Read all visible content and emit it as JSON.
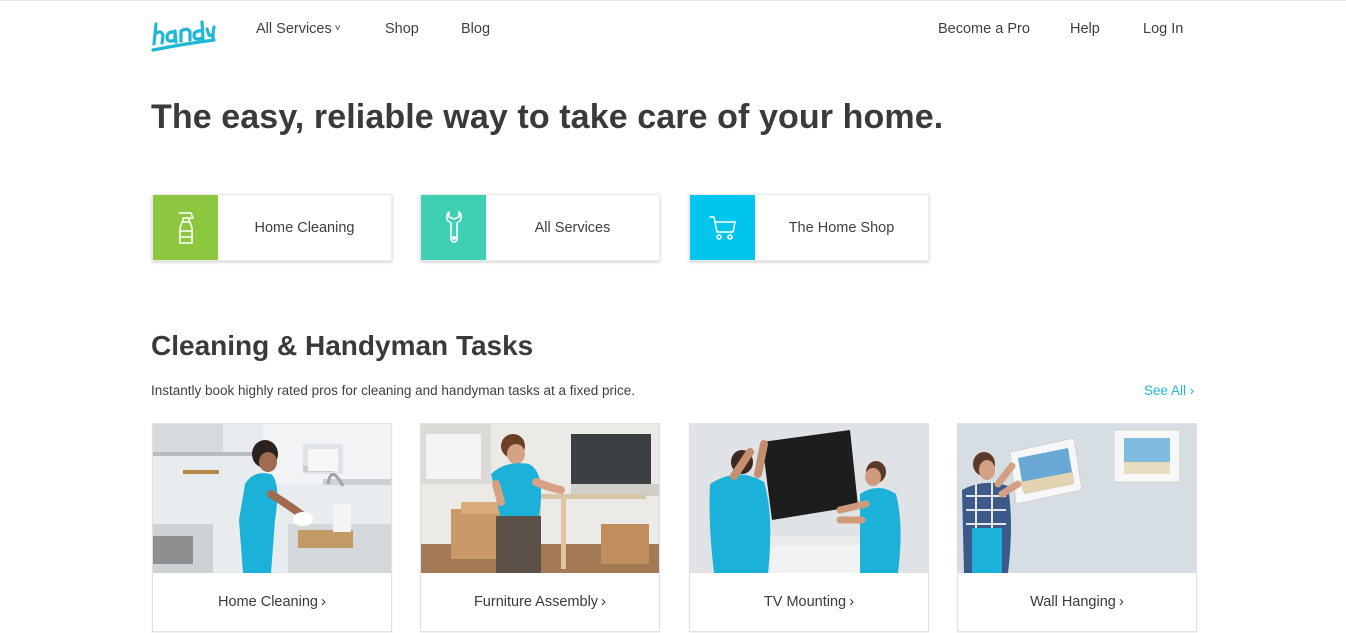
{
  "brand": {
    "logo_text": "handy",
    "accent": "#21b7d4"
  },
  "nav": {
    "left": [
      {
        "label": "All Services",
        "has_chevron": true
      },
      {
        "label": "Shop"
      },
      {
        "label": "Blog"
      }
    ],
    "right": [
      {
        "label": "Become a Pro"
      },
      {
        "label": "Help"
      },
      {
        "label": "Log In"
      }
    ],
    "chevron": "˅"
  },
  "hero": {
    "title": "The easy, reliable way to take care of your home."
  },
  "categories": [
    {
      "label": "Home Cleaning",
      "icon": "spray-bottle-icon",
      "color": "#8dc63f"
    },
    {
      "label": "All Services",
      "icon": "wrench-icon",
      "color": "#3fd0b4"
    },
    {
      "label": "The Home Shop",
      "icon": "cart-icon",
      "color": "#00c5ec"
    }
  ],
  "section": {
    "title": "Cleaning & Handyman Tasks",
    "subtitle": "Instantly book highly rated pros for cleaning and handyman tasks at a fixed price.",
    "see_all": "See All",
    "arrow": "›"
  },
  "tasks": [
    {
      "label": "Home Cleaning",
      "image": "woman-cleaning-kitchen-photo"
    },
    {
      "label": "Furniture Assembly",
      "image": "man-assembling-table-photo"
    },
    {
      "label": "TV Mounting",
      "image": "men-mounting-tv-photo"
    },
    {
      "label": "Wall Hanging",
      "image": "man-hanging-picture-photo"
    }
  ]
}
